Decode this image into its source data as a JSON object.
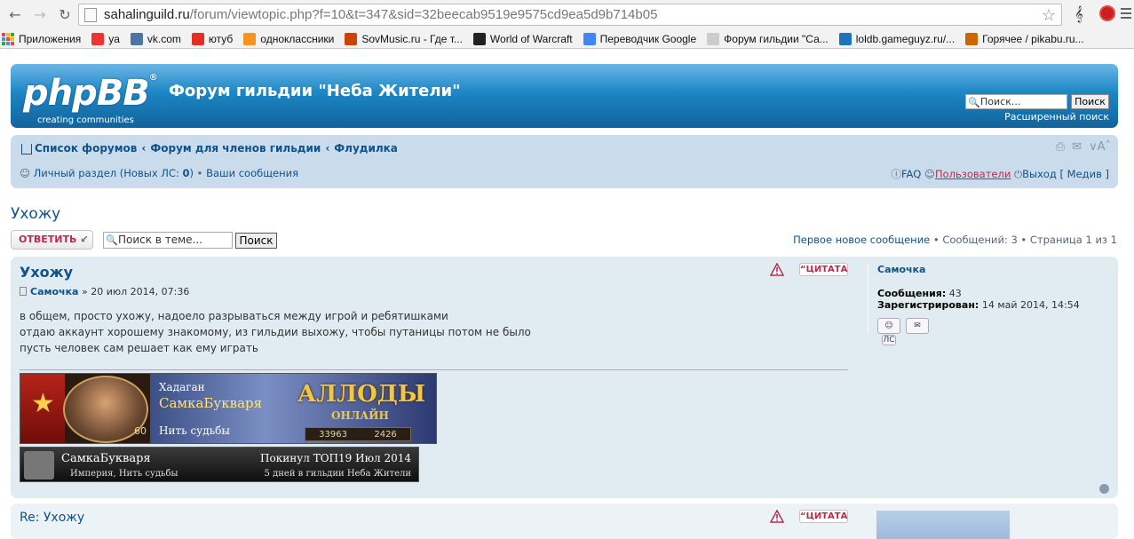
{
  "browser": {
    "url_host": "sahalinguild.ru",
    "url_path": "/forum/viewtopic.php?f=10&t=347&sid=32beecab9519e9575cd9ea5d9b714b05",
    "bookmarks": [
      {
        "label": "Приложения",
        "color": "#e44"
      },
      {
        "label": "ya",
        "color": "#e33"
      },
      {
        "label": "vk.com",
        "color": "#4c75a3"
      },
      {
        "label": "ютуб",
        "color": "#e52d27"
      },
      {
        "label": "одноклассники",
        "color": "#f7931e"
      },
      {
        "label": "SovMusic.ru - Где т...",
        "color": "#c40"
      },
      {
        "label": "World of Warcraft",
        "color": "#222"
      },
      {
        "label": "Переводчик Google",
        "color": "#4285f4"
      },
      {
        "label": "Форум гильдии \"Са...",
        "color": "#ccc"
      },
      {
        "label": "loldb.gameguyz.ru/...",
        "color": "#1e73be"
      },
      {
        "label": "Горячее / pikabu.ru...",
        "color": "#c60"
      }
    ]
  },
  "header": {
    "logo_text": "phpBB",
    "logo_sub": "creating communities",
    "site_title": "Форум гильдии \"Неба Жители\"",
    "search_placeholder": "Поиск...",
    "search_button": "Поиск",
    "advanced_search": "Расширенный поиск"
  },
  "navbar": {
    "crumbs": [
      "Список форумов",
      "Форум для членов гильдии",
      "Флудилка"
    ],
    "personal": "Личный раздел (Новых ЛС: ",
    "personal_count": "0",
    "personal_end": ")",
    "your_posts": "Ваши сообщения",
    "faq": "FAQ",
    "users": "Пользователи",
    "logout": "Выход [ Медив ]"
  },
  "topic": {
    "title": "Ухожу",
    "reply_label": "ОТВЕТИТЬ",
    "search_placeholder": "Поиск в теме...",
    "search_button": "Поиск",
    "first_new": "Первое новое сообщение",
    "pagination": " • Сообщений: 3 • Страница 1 из 1"
  },
  "post1": {
    "title": "Ухожу",
    "author": "Самочка",
    "date": " » 20 июл 2014, 07:36",
    "quote": "ЦИТАТА",
    "lines": [
      "в общем, просто ухожу, надоело разрываться между игрой и ребятишками",
      "отдаю аккаунт хорошему знакомому, из гильдии выхожу, чтобы путаницы потом не было",
      "пусть человек сам решает как ему играть"
    ],
    "profile": {
      "name": "Самочка",
      "posts_label": "Сообщения:",
      "posts_value": "43",
      "reg_label": "Зарегистрирован:",
      "reg_value": "14 май 2014, 14:54",
      "pm": "ЛС"
    },
    "banner1": {
      "level": "60",
      "guild": "Хадаган",
      "char": "СамкаБукваря",
      "path": "Нить судьбы",
      "game": "АЛЛОДЫ",
      "game_sub": "ОНЛАЙН",
      "stat1": "33963",
      "stat2": "2426"
    },
    "banner2": {
      "name": "СамкаБукваря",
      "guild": "Империя, Нить судьбы",
      "left_top": "Покинул ТОП19 Июл 2014",
      "days": "5 дней в гильдии Неба Жители"
    }
  },
  "post2": {
    "title": "Re: Ухожу",
    "quote": "ЦИТАТА"
  }
}
